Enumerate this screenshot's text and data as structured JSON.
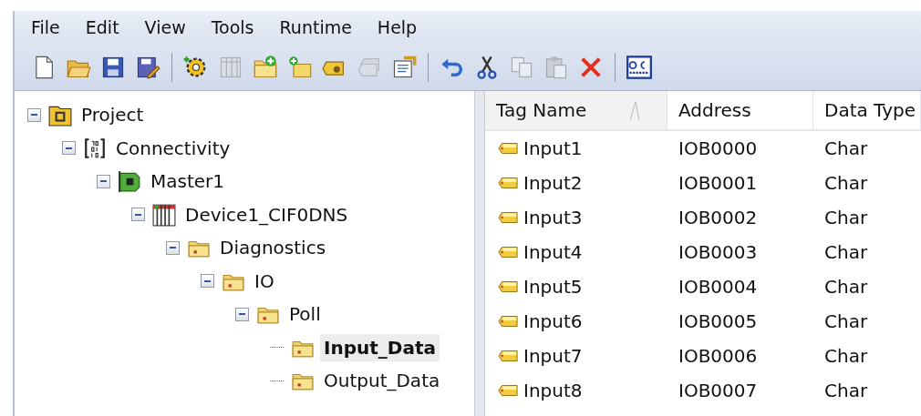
{
  "menu": [
    {
      "label": "File"
    },
    {
      "label": "Edit"
    },
    {
      "label": "View"
    },
    {
      "label": "Tools"
    },
    {
      "label": "Runtime"
    },
    {
      "label": "Help"
    }
  ],
  "toolbar": [
    [
      {
        "kind": "new",
        "disabled": false
      },
      {
        "kind": "open",
        "disabled": false
      },
      {
        "kind": "save",
        "disabled": false
      },
      {
        "kind": "saveas",
        "disabled": false
      }
    ],
    [
      {
        "kind": "gear",
        "disabled": false
      },
      {
        "kind": "columns",
        "disabled": true
      },
      {
        "kind": "folderadd",
        "disabled": false
      },
      {
        "kind": "foldersmall",
        "disabled": false
      },
      {
        "kind": "tag",
        "disabled": false
      },
      {
        "kind": "tags",
        "disabled": true
      },
      {
        "kind": "properties",
        "disabled": false
      }
    ],
    [
      {
        "kind": "undo",
        "disabled": false
      },
      {
        "kind": "cut",
        "disabled": false
      },
      {
        "kind": "copy",
        "disabled": true
      },
      {
        "kind": "paste",
        "disabled": true
      },
      {
        "kind": "delete",
        "disabled": false
      }
    ],
    [
      {
        "kind": "qc",
        "disabled": false
      }
    ]
  ],
  "tree": [
    {
      "label": "Project",
      "kind": "project",
      "expanded": true,
      "selected": false,
      "children": [
        {
          "label": "Connectivity",
          "kind": "connectivity",
          "expanded": true,
          "selected": false,
          "children": [
            {
              "label": "Master1",
              "kind": "card",
              "expanded": true,
              "selected": false,
              "children": [
                {
                  "label": "Device1_CIF0DNS",
                  "kind": "device",
                  "expanded": true,
                  "selected": false,
                  "children": [
                    {
                      "label": "Diagnostics",
                      "kind": "folder",
                      "expanded": true,
                      "selected": false,
                      "children": [
                        {
                          "label": "IO",
                          "kind": "folder",
                          "expanded": true,
                          "selected": false,
                          "children": [
                            {
                              "label": "Poll",
                              "kind": "folder",
                              "expanded": true,
                              "selected": false,
                              "children": [
                                {
                                  "label": "Input_Data",
                                  "kind": "folder",
                                  "selected": true
                                },
                                {
                                  "label": "Output_Data",
                                  "kind": "folder",
                                  "selected": false
                                }
                              ]
                            }
                          ]
                        }
                      ]
                    }
                  ]
                }
              ]
            }
          ]
        }
      ]
    }
  ],
  "table": {
    "columns": [
      {
        "label": "Tag Name",
        "sorted": true
      },
      {
        "label": "Address",
        "sorted": false
      },
      {
        "label": "Data Type",
        "sorted": false
      }
    ],
    "rows": [
      [
        "Input1",
        "IOB0000",
        "Char"
      ],
      [
        "Input2",
        "IOB0001",
        "Char"
      ],
      [
        "Input3",
        "IOB0002",
        "Char"
      ],
      [
        "Input4",
        "IOB0003",
        "Char"
      ],
      [
        "Input5",
        "IOB0004",
        "Char"
      ],
      [
        "Input6",
        "IOB0005",
        "Char"
      ],
      [
        "Input7",
        "IOB0006",
        "Char"
      ],
      [
        "Input8",
        "IOB0007",
        "Char"
      ]
    ]
  }
}
